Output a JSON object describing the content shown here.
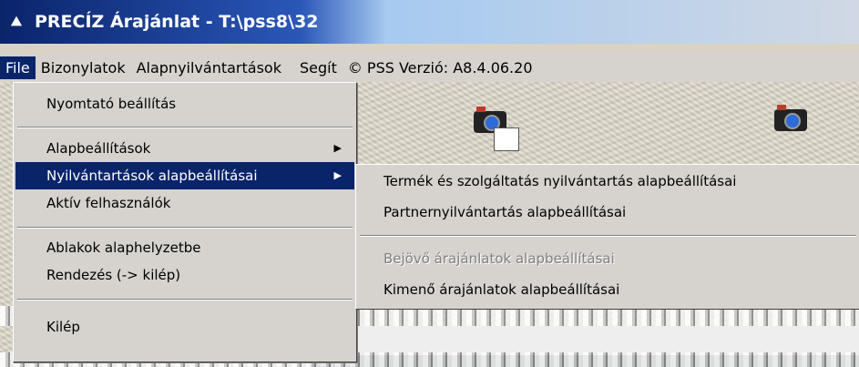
{
  "window": {
    "title": "PRECÍZ Árajánlat - T:\\pss8\\32"
  },
  "menubar": {
    "items": [
      {
        "label": "File"
      },
      {
        "label": "Bizonylatok"
      },
      {
        "label": "Alapnyilvántartások"
      },
      {
        "label": "Segít"
      },
      {
        "label": "© PSS Verzió: A8.4.06.20"
      }
    ]
  },
  "file_menu": {
    "items": [
      {
        "label": "Nyomtató beállítás"
      },
      {
        "label": "Alapbeállítások"
      },
      {
        "label": "Nyilvántartások alapbeállításai"
      },
      {
        "label": "Aktív felhasználók"
      },
      {
        "label": "Ablakok alaphelyzetbe"
      },
      {
        "label": "Rendezés (-> kilép)"
      },
      {
        "label": "Kilép"
      }
    ]
  },
  "submenu": {
    "items": [
      {
        "label": "Termék és szolgáltatás nyilvántartás alapbeállításai",
        "enabled": true
      },
      {
        "label": "Partnernyilvántartás alapbeállításai",
        "enabled": true
      },
      {
        "label": "Bejövő árajánlatok alapbeállításai",
        "enabled": false
      },
      {
        "label": "Kimenő árajánlatok alapbeállításai",
        "enabled": true
      }
    ]
  },
  "colors": {
    "titlebar": "#0a246a",
    "selection": "#0a246a",
    "menu_bg": "#d6d3ce",
    "disabled_text": "#808080"
  }
}
